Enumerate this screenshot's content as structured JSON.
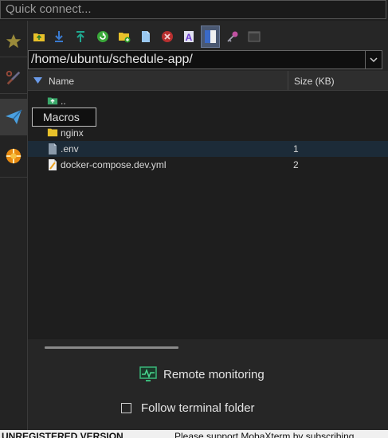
{
  "quick_connect": {
    "placeholder": "Quick connect..."
  },
  "leftbar": {
    "items": [
      {
        "name": "star-icon"
      },
      {
        "name": "tools-icon"
      },
      {
        "name": "send-icon"
      },
      {
        "name": "macros-icon"
      }
    ]
  },
  "toolbar": {
    "icons": [
      "parent-folder-icon",
      "download-icon",
      "upload-icon",
      "refresh-icon",
      "new-folder-icon",
      "new-file-icon",
      "delete-icon",
      "rename-icon",
      "toggle-panel-icon",
      "key-icon",
      "terminal-icon"
    ]
  },
  "path": {
    "value": "/home/ubuntu/schedule-app/"
  },
  "columns": {
    "name": "Name",
    "size": "Size (KB)"
  },
  "files": [
    {
      "name": "..",
      "size": "",
      "type": "parent"
    },
    {
      "name": "",
      "size": "",
      "type": "folder"
    },
    {
      "name": "nginx",
      "size": "",
      "type": "folder"
    },
    {
      "name": ".env",
      "size": "1",
      "type": "file"
    },
    {
      "name": "docker-compose.dev.yml",
      "size": "2",
      "type": "yml"
    }
  ],
  "tooltip": {
    "text": "Macros"
  },
  "remote_monitoring": {
    "label": "Remote monitoring"
  },
  "follow_terminal": {
    "label": "Follow terminal folder",
    "checked": false
  },
  "status": {
    "unregistered": "UNREGISTERED VERSION",
    "support": "Please support MobaXterm by subscribing"
  },
  "colors": {
    "accent": "#4a5872",
    "highlight_row": "#1c2b38",
    "folder": "#e8c12a"
  }
}
